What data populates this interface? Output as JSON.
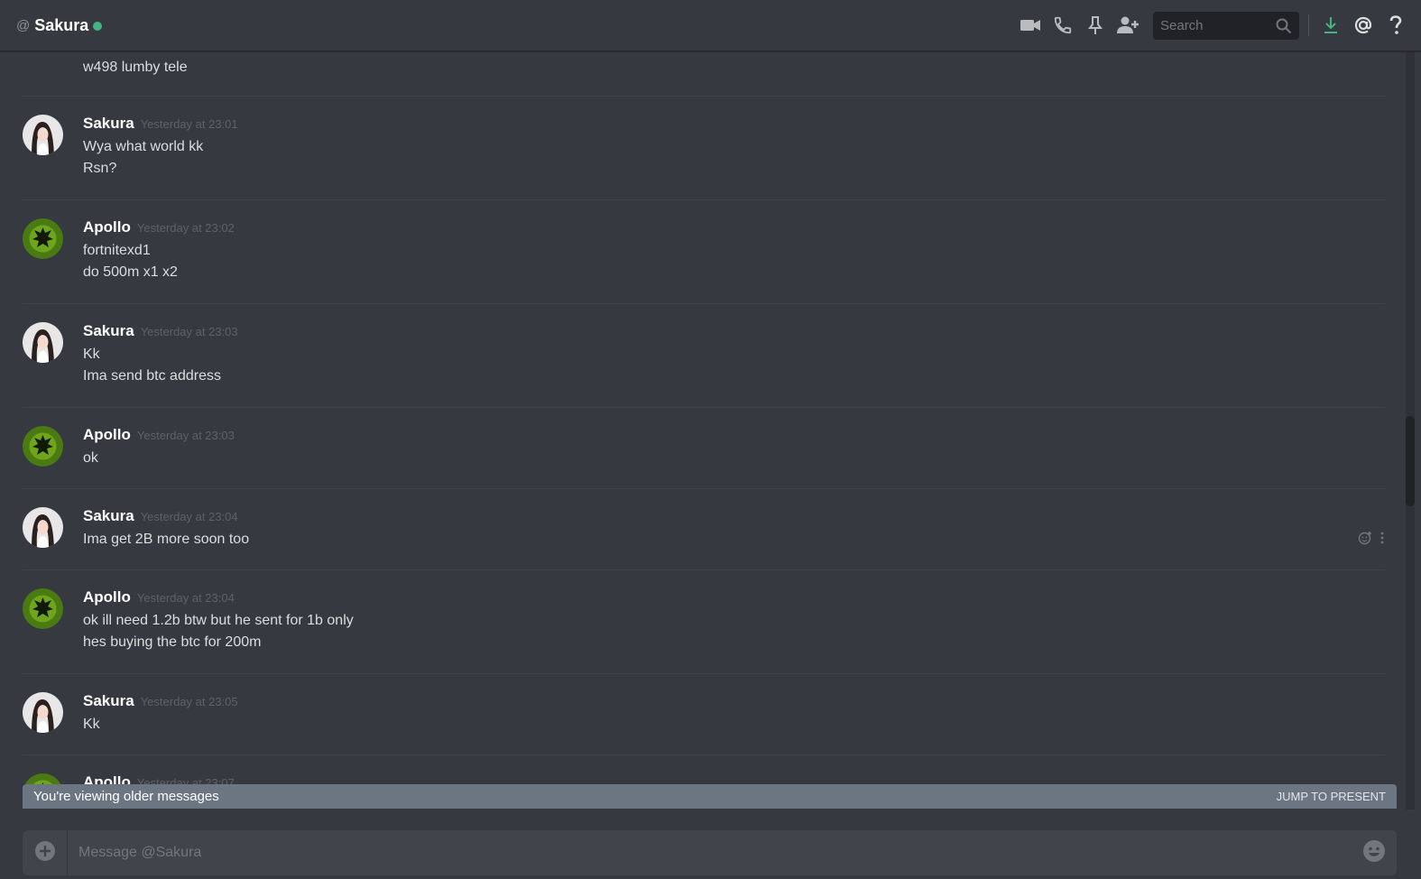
{
  "header": {
    "at_symbol": "@",
    "title": "Sakura",
    "search_placeholder": "Search"
  },
  "messages": [
    {
      "lines": [
        "w498 lumby tele"
      ]
    },
    {
      "user": "Sakura",
      "time": "Yesterday at 23:01",
      "lines": [
        "Wya what world kk",
        "Rsn?"
      ]
    },
    {
      "user": "Apollo",
      "time": "Yesterday at 23:02",
      "lines": [
        "fortnitexd1",
        "do 500m x1 x2"
      ]
    },
    {
      "user": "Sakura",
      "time": "Yesterday at 23:03",
      "lines": [
        "Kk",
        "Ima send btc address"
      ]
    },
    {
      "user": "Apollo",
      "time": "Yesterday at 23:03",
      "lines": [
        "ok"
      ]
    },
    {
      "user": "Sakura",
      "time": "Yesterday at 23:04",
      "lines": [
        "Ima get 2B more soon too"
      ]
    },
    {
      "user": "Apollo",
      "time": "Yesterday at 23:04",
      "lines": [
        "ok ill need 1.2b btw but he sent for 1b only",
        "hes buying the btc for 200m"
      ]
    },
    {
      "user": "Sakura",
      "time": "Yesterday at 23:05",
      "lines": [
        "Kk"
      ]
    },
    {
      "user": "Apollo",
      "time": "Yesterday at 23:07",
      "lines": []
    }
  ],
  "older_bar": {
    "text": "You're viewing older messages",
    "jump_label": "JUMP TO PRESENT"
  },
  "composer": {
    "placeholder": "Message @Sakura"
  },
  "colors": {
    "background": "#36393f",
    "online": "#43b581",
    "download_accent": "#43b581",
    "apollo_avatar": "#4a7a12"
  },
  "icons": [
    "video-call-icon",
    "voice-call-icon",
    "pin-icon",
    "add-friend-icon",
    "search-icon",
    "download-icon",
    "mention-icon",
    "help-icon",
    "attach-icon",
    "emoji-icon",
    "add-reaction-icon",
    "more-icon"
  ]
}
